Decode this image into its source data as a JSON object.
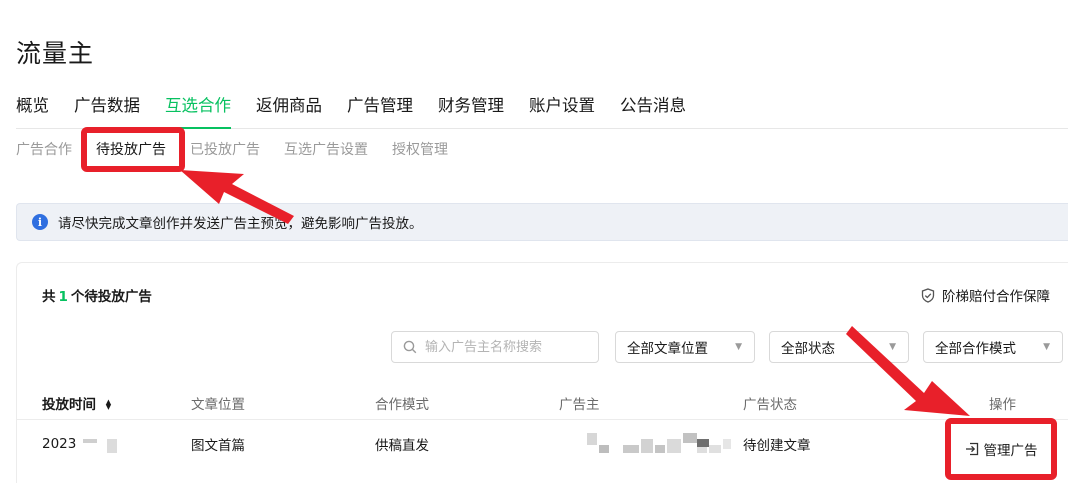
{
  "app": {
    "title": "流量主"
  },
  "nav": {
    "items": [
      {
        "label": "概览"
      },
      {
        "label": "广告数据"
      },
      {
        "label": "互选合作"
      },
      {
        "label": "返佣商品"
      },
      {
        "label": "广告管理"
      },
      {
        "label": "财务管理"
      },
      {
        "label": "账户设置"
      },
      {
        "label": "公告消息"
      }
    ],
    "active": "互选合作"
  },
  "subnav": {
    "items": [
      {
        "label": "广告合作"
      },
      {
        "label": "待投放广告"
      },
      {
        "label": "已投放广告"
      },
      {
        "label": "互选广告设置"
      },
      {
        "label": "授权管理"
      }
    ],
    "active": "待投放广告"
  },
  "notice": {
    "text": "请尽快完成文章创作并发送广告主预览，避免影响广告投放。"
  },
  "summary": {
    "prefix": "共",
    "count": "1",
    "suffix": "个待投放广告"
  },
  "guarantee": {
    "label": "阶梯赔付合作保障"
  },
  "filters": {
    "search_placeholder": "输入广告主名称搜索",
    "position": "全部文章位置",
    "status": "全部状态",
    "mode": "全部合作模式"
  },
  "table": {
    "headers": {
      "time": "投放时间",
      "position": "文章位置",
      "mode": "合作模式",
      "advertiser": "广告主",
      "status": "广告状态",
      "action": "操作"
    },
    "rows": [
      {
        "time": "2023",
        "position": "图文首篇",
        "mode": "供稿直发",
        "status": "待创建文章",
        "action": "管理广告"
      }
    ]
  },
  "colors": {
    "accent": "#07c160",
    "annotation": "#e8202a",
    "info": "#2f6fe0"
  }
}
